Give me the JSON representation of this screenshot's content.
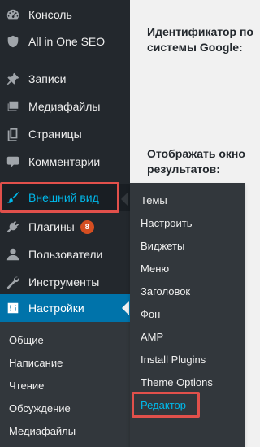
{
  "content": {
    "google_id_label": "Идентификатор по\nсистемы Google:",
    "results_window_label": "Отображать окно\nрезультатов:"
  },
  "sidebar": {
    "items": [
      {
        "label": "Консоль",
        "icon": "dashboard-icon"
      },
      {
        "label": "All in One SEO",
        "icon": "shield-icon"
      },
      {
        "label": "Записи",
        "icon": "pushpin-icon"
      },
      {
        "label": "Медиафайлы",
        "icon": "media-icon"
      },
      {
        "label": "Страницы",
        "icon": "pages-icon"
      },
      {
        "label": "Комментарии",
        "icon": "comments-icon"
      },
      {
        "label": "Внешний вид",
        "icon": "paintbrush-icon"
      },
      {
        "label": "Плагины",
        "icon": "plugins-icon",
        "badge": "8"
      },
      {
        "label": "Пользователи",
        "icon": "users-icon"
      },
      {
        "label": "Инструменты",
        "icon": "tools-icon"
      },
      {
        "label": "Настройки",
        "icon": "settings-icon"
      }
    ],
    "settings_submenu": [
      "Общие",
      "Написание",
      "Чтение",
      "Обсуждение",
      "Медиафайлы"
    ]
  },
  "appearance_flyout": {
    "items": [
      "Темы",
      "Настроить",
      "Виджеты",
      "Меню",
      "Заголовок",
      "Фон",
      "AMP",
      "Install Plugins",
      "Theme Options",
      "Редактор"
    ]
  },
  "colors": {
    "sidebar_bg": "#23282d",
    "submenu_bg": "#32373c",
    "current_bg": "#0073aa",
    "hover_text": "#00b9eb",
    "highlight_border": "#e1504b",
    "badge_bg": "#d54e21"
  }
}
